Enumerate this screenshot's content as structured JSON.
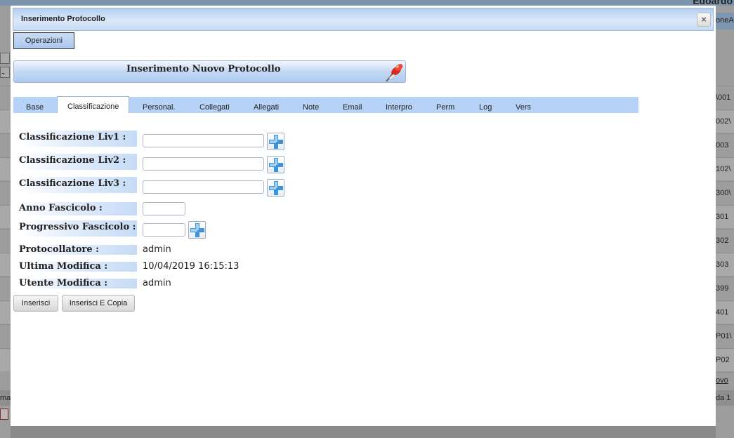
{
  "background": {
    "user_name": "Edoardo",
    "right_header": "oneAl",
    "right_cells": [
      "\\001",
      "002\\",
      "003",
      "102\\",
      "300\\",
      "301",
      "302",
      "303",
      "399",
      "401",
      "P01\\",
      "P02"
    ],
    "right_link": "ovo",
    "right_footer": "da 1",
    "left_footer": "ma"
  },
  "dialog": {
    "title": "Inserimento Protocollo",
    "close_label": "×",
    "operazioni_label": "Operazioni",
    "section_title": "Inserimento Nuovo Protocollo"
  },
  "tabs": [
    {
      "label": "Base"
    },
    {
      "label": "Classificazione",
      "active": true
    },
    {
      "label": "Personal."
    },
    {
      "label": "Collegati"
    },
    {
      "label": "Allegati"
    },
    {
      "label": "Note"
    },
    {
      "label": "Email"
    },
    {
      "label": "Interpro"
    },
    {
      "label": "Perm"
    },
    {
      "label": "Log"
    },
    {
      "label": "Vers"
    }
  ],
  "form": {
    "classificazione_liv1": {
      "label": "Classificazione Liv1 :",
      "value": ""
    },
    "classificazione_liv2": {
      "label": "Classificazione Liv2 :",
      "value": ""
    },
    "classificazione_liv3": {
      "label": "Classificazione Liv3 :",
      "value": ""
    },
    "anno_fascicolo": {
      "label": "Anno Fascicolo :",
      "value": ""
    },
    "progressivo_fascicolo": {
      "label": "Progressivo Fascicolo :",
      "value": ""
    },
    "protocollatore": {
      "label": "Protocollatore :",
      "value": "admin"
    },
    "ultima_modifica": {
      "label": "Ultima Modifica :",
      "value": "10/04/2019 16:15:13"
    },
    "utente_modifica": {
      "label": "Utente Modifica :",
      "value": "admin"
    }
  },
  "buttons": {
    "inserisci": "Inserisci",
    "inserisci_copia": "Inserisci E Copia"
  },
  "colors": {
    "titlebar": "#c7dbf3",
    "tabbar": "#b6d2f7",
    "overlay": "#8a8a8a"
  }
}
